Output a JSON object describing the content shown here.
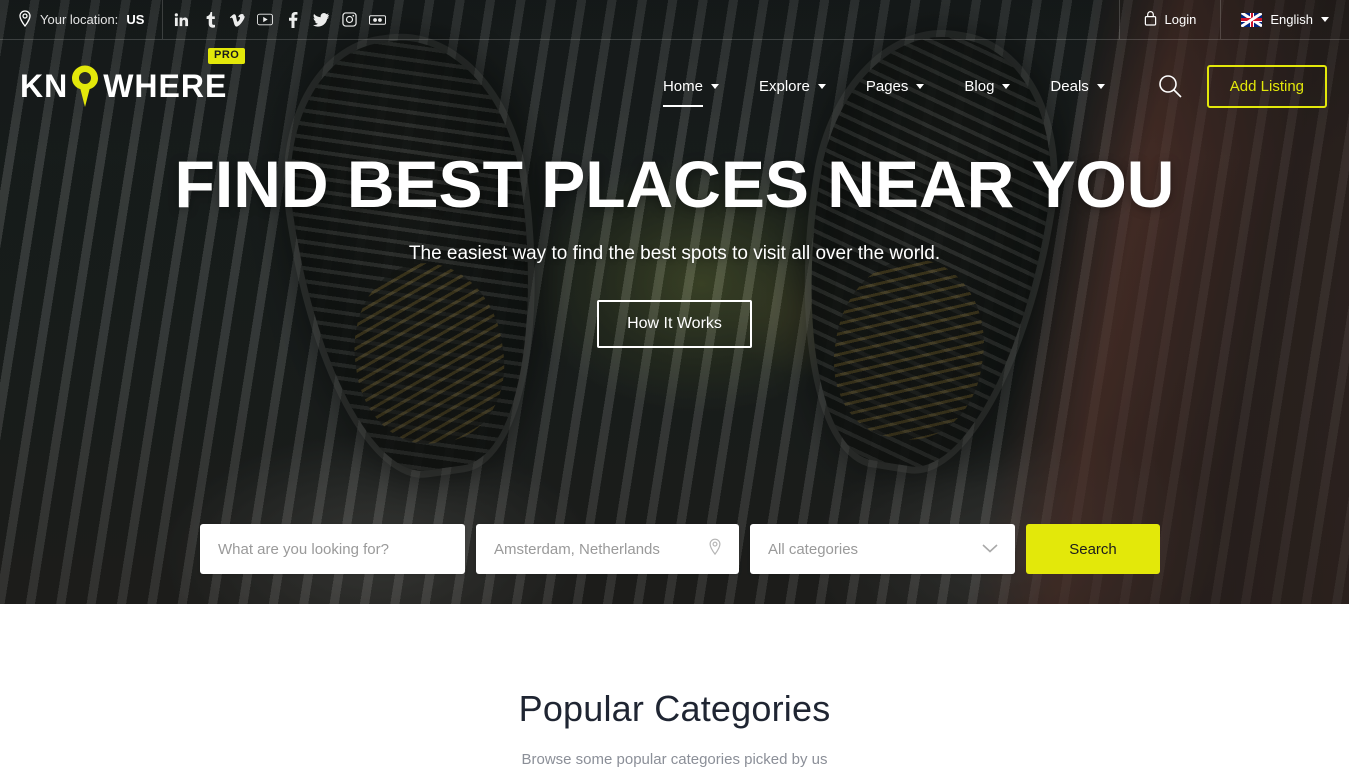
{
  "topbar": {
    "location_label": "Your location:",
    "location_value": "US",
    "location_icon": "map-pin-icon",
    "socials": [
      {
        "name": "linkedin",
        "glyph": "in"
      },
      {
        "name": "tumblr",
        "glyph": "t"
      },
      {
        "name": "vimeo",
        "glyph": "v"
      },
      {
        "name": "youtube",
        "glyph": "yt"
      },
      {
        "name": "facebook",
        "glyph": "f"
      },
      {
        "name": "twitter",
        "glyph": "tw"
      },
      {
        "name": "instagram",
        "glyph": "ig"
      },
      {
        "name": "flickr",
        "glyph": "fl"
      }
    ],
    "login_label": "Login",
    "login_icon": "lock-icon",
    "language_label": "English",
    "language_flag": "uk-flag-icon"
  },
  "header": {
    "logo": {
      "text_before": "KN",
      "text_after": "WHERE",
      "badge": "PRO",
      "pin_icon": "map-pin-icon"
    },
    "nav": [
      {
        "label": "Home",
        "active": true,
        "has_dropdown": true
      },
      {
        "label": "Explore",
        "active": false,
        "has_dropdown": true
      },
      {
        "label": "Pages",
        "active": false,
        "has_dropdown": true
      },
      {
        "label": "Blog",
        "active": false,
        "has_dropdown": true
      },
      {
        "label": "Deals",
        "active": false,
        "has_dropdown": true
      }
    ],
    "search_icon": "search-icon",
    "add_listing_label": "Add Listing"
  },
  "hero": {
    "title": "FIND BEST PLACES NEAR YOU",
    "subtitle": "The easiest way to find the best spots to visit all over the world.",
    "cta_label": "How It Works"
  },
  "search": {
    "keyword_placeholder": "What are you looking for?",
    "location_placeholder": "Amsterdam, Netherlands",
    "location_icon": "map-pin-icon",
    "category_value": "All categories",
    "category_icon": "chevron-down-icon",
    "button_label": "Search"
  },
  "popular": {
    "title": "Popular Categories",
    "subtitle": "Browse some popular categories picked by us"
  },
  "colors": {
    "accent_yellow": "#e3e80a",
    "dark_text": "#1f2532",
    "muted_text": "#8b8f98",
    "white": "#ffffff"
  }
}
